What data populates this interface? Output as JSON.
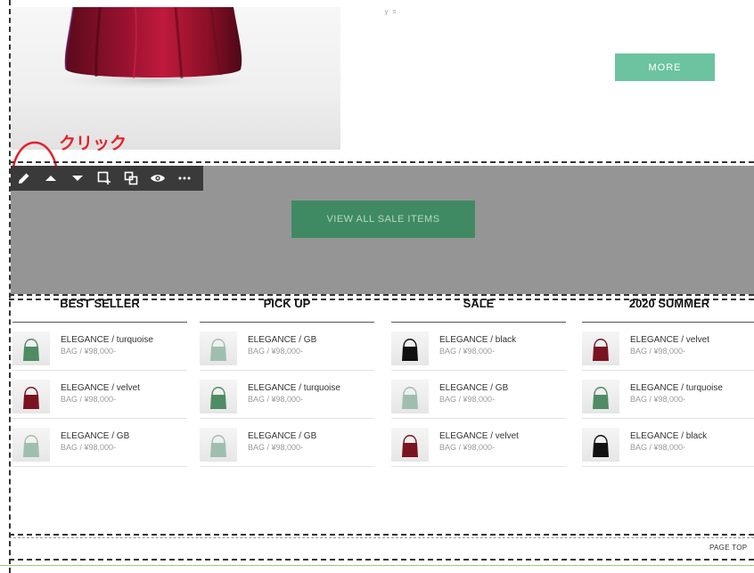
{
  "top": {
    "more_label": "MORE",
    "tiny_mark": "ｙ ｓ"
  },
  "annotation": {
    "label": "クリック"
  },
  "toolbar": {
    "buttons": [
      {
        "name": "edit-pencil-icon"
      },
      {
        "name": "move-up-icon"
      },
      {
        "name": "move-down-icon"
      },
      {
        "name": "add-section-icon"
      },
      {
        "name": "duplicate-icon"
      },
      {
        "name": "visibility-eye-icon"
      },
      {
        "name": "more-options-icon"
      }
    ]
  },
  "sale_section": {
    "button_label": "VIEW ALL SALE ITEMS"
  },
  "columns": [
    {
      "title": "BEST SELLER",
      "items": [
        {
          "name": "ELEGANCE / turquoise",
          "price": "BAG / ¥98,000-",
          "color": "#4f8b63"
        },
        {
          "name": "ELEGANCE / velvet",
          "price": "BAG / ¥98,000-",
          "color": "#7a1420"
        },
        {
          "name": "ELEGANCE / GB",
          "price": "BAG / ¥98,000-",
          "color": "#9fbfae"
        }
      ]
    },
    {
      "title": "PICK UP",
      "items": [
        {
          "name": "ELEGANCE / GB",
          "price": "BAG / ¥98,000-",
          "color": "#9fbfae"
        },
        {
          "name": "ELEGANCE / turquoise",
          "price": "BAG / ¥98,000-",
          "color": "#4f8b63"
        },
        {
          "name": "ELEGANCE / GB",
          "price": "BAG / ¥98,000-",
          "color": "#9fbfae"
        }
      ]
    },
    {
      "title": "SALE",
      "items": [
        {
          "name": "ELEGANCE / black",
          "price": "BAG / ¥98,000-",
          "color": "#111111"
        },
        {
          "name": "ELEGANCE / GB",
          "price": "BAG / ¥98,000-",
          "color": "#9fbfae"
        },
        {
          "name": "ELEGANCE / velvet",
          "price": "BAG / ¥98,000-",
          "color": "#7a1420"
        }
      ]
    },
    {
      "title": "2020 SUMMER",
      "items": [
        {
          "name": "ELEGANCE / velvet",
          "price": "BAG / ¥98,000-",
          "color": "#7a1420"
        },
        {
          "name": "ELEGANCE / turquoise",
          "price": "BAG / ¥98,000-",
          "color": "#4f8b63"
        },
        {
          "name": "ELEGANCE / black",
          "price": "BAG / ¥98,000-",
          "color": "#111111"
        }
      ]
    }
  ],
  "footer": {
    "page_top_label": "PAGE TOP"
  },
  "colors": {
    "more_button": "#6cc3a0",
    "sale_button": "#3f8a62",
    "selected_section": "#959595",
    "annotation": "#e2222a"
  }
}
